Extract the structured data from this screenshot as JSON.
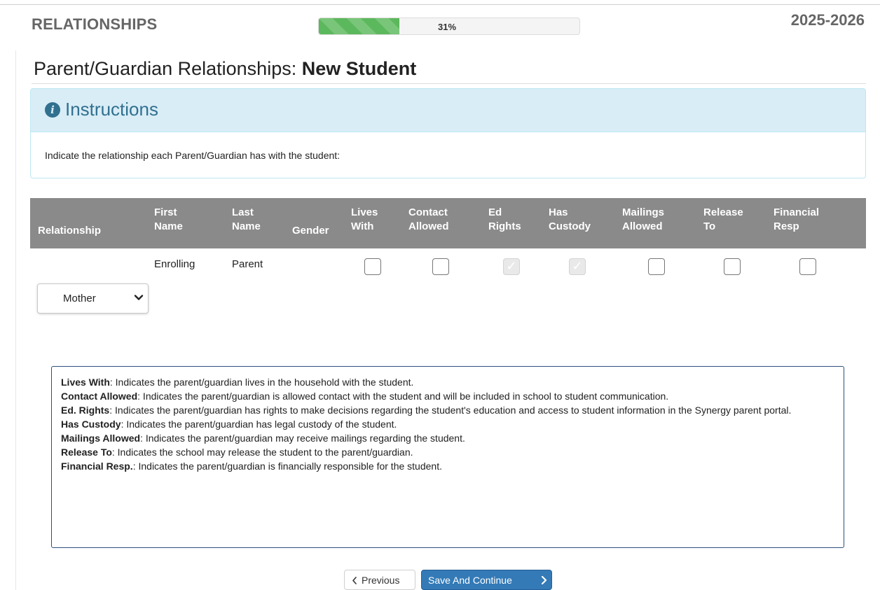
{
  "header": {
    "section_title": "RELATIONSHIPS",
    "progress": {
      "percent": 31,
      "label": "31%"
    },
    "school_year": "2025-2026"
  },
  "page": {
    "title_prefix": "Parent/Guardian Relationships: ",
    "title_student": "New Student"
  },
  "instructions": {
    "icon": "info-circle-icon",
    "title": "Instructions",
    "text": "Indicate the relationship each Parent/Guardian has with the student:"
  },
  "table": {
    "headers": {
      "relationship": "Relationship",
      "first_name_1": "First",
      "first_name_2": "Name",
      "last_name_1": "Last",
      "last_name_2": "Name",
      "gender": "Gender",
      "lives_with_1": "Lives",
      "lives_with_2": "With",
      "contact_allowed_1": "Contact",
      "contact_allowed_2": "Allowed",
      "ed_rights_1": "Ed",
      "ed_rights_2": "Rights",
      "has_custody_1": "Has",
      "has_custody_2": "Custody",
      "mailings_allowed_1": "Mailings",
      "mailings_allowed_2": "Allowed",
      "release_to_1": "Release",
      "release_to_2": "To",
      "financial_resp_1": "Financial",
      "financial_resp_2": "Resp"
    },
    "row": {
      "first_name": "Enrolling",
      "last_name": "Parent",
      "gender": "",
      "relationship": "Mother",
      "lives_with": false,
      "contact_allowed": false,
      "ed_rights": true,
      "has_custody": true,
      "mailings_allowed": false,
      "release_to": false,
      "financial_resp": false
    }
  },
  "legend": {
    "lives_with_term": "Lives With",
    "lives_with_desc": ": Indicates the parent/guardian lives in the household with the student.",
    "contact_allowed_term": "Contact Allowed",
    "contact_allowed_desc": ": Indicates the parent/guardian is allowed contact with the student and will be included in school to student communication.",
    "ed_rights_term": "Ed. Rights",
    "ed_rights_desc": ": Indicates the parent/guardian has rights to make decisions regarding the student's education and access to student information in the Synergy parent portal.",
    "has_custody_term": "Has Custody",
    "has_custody_desc": ": Indicates the parent/guardian has legal custody of the student.",
    "mailings_allowed_term": "Mailings Allowed",
    "mailings_allowed_desc": ": Indicates the parent/guardian may receive mailings regarding the student.",
    "release_to_term": "Release To",
    "release_to_desc": ": Indicates the school may release the student to the parent/guardian.",
    "financial_resp_term": "Financial Resp.",
    "financial_resp_desc": ": Indicates the parent/guardian is financially responsible for the student."
  },
  "nav": {
    "previous_label": "Previous",
    "save_continue_label": "Save And Continue"
  },
  "colors": {
    "progress": "#5cb85c",
    "header_gray": "#8a8a8a",
    "info_panel": "#d9edf7",
    "info_text": "#31708f",
    "primary": "#337ab7"
  }
}
